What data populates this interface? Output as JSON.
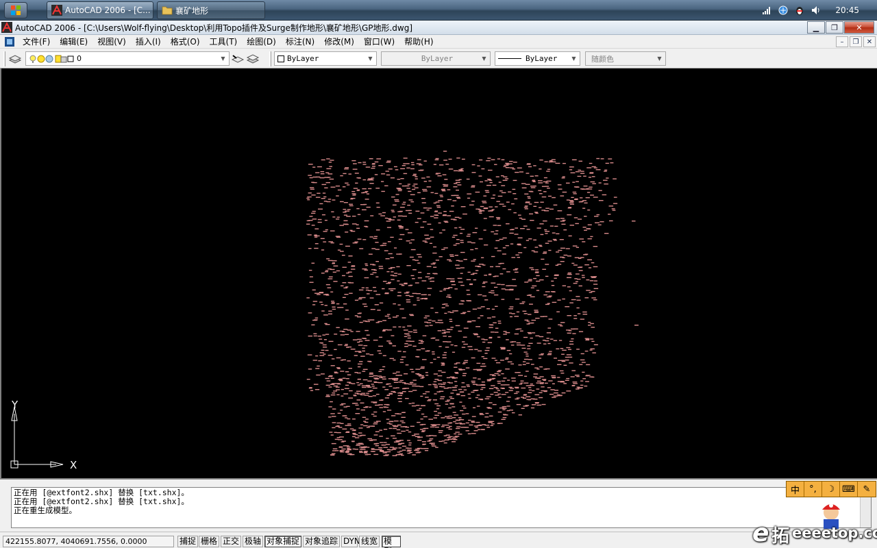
{
  "taskbar": {
    "tasks": [
      {
        "label": "AutoCAD 2006 - [C..."
      },
      {
        "label": "襄矿地形"
      }
    ],
    "clock": "20:45"
  },
  "window": {
    "title": "AutoCAD 2006 - [C:\\Users\\Wolf-flying\\Desktop\\利用Topo插件及Surge制作地形\\襄矿地形\\GP地形.dwg]"
  },
  "menu": {
    "items": [
      "文件(F)",
      "编辑(E)",
      "视图(V)",
      "插入(I)",
      "格式(O)",
      "工具(T)",
      "绘图(D)",
      "标注(N)",
      "修改(M)",
      "窗口(W)",
      "帮助(H)"
    ]
  },
  "toolbar": {
    "layer_value": "0",
    "color_value": "ByLayer",
    "linetype_value": "ByLayer",
    "lineweight_value": "ByLayer",
    "plotstyle_value": "随颜色"
  },
  "canvas": {
    "ucs_x_label": "X",
    "ucs_y_label": "Y",
    "point_color": "#d88a8a",
    "background": "#000000"
  },
  "command": {
    "lines": [
      "正在用 [@extfont2.shx] 替换 [txt.shx]。",
      "正在用 [@extfont2.shx] 替换 [txt.shx]。",
      "正在重生成模型。"
    ]
  },
  "status": {
    "coords": "422155.8077, 4040691.7556, 0.0000",
    "toggles": [
      {
        "label": "捕捉",
        "on": false
      },
      {
        "label": "栅格",
        "on": false
      },
      {
        "label": "正交",
        "on": false
      },
      {
        "label": "极轴",
        "on": false
      },
      {
        "label": "对象捕捉",
        "on": true
      },
      {
        "label": "对象追踪",
        "on": false
      },
      {
        "label": "DYN",
        "on": false
      },
      {
        "label": "线宽",
        "on": false
      },
      {
        "label": "模型",
        "on": true
      }
    ]
  },
  "ime": {
    "buttons": [
      "中",
      "°,",
      "☽"
    ]
  },
  "watermark": {
    "brand_char": "拓",
    "site": "eeeetop.com"
  }
}
